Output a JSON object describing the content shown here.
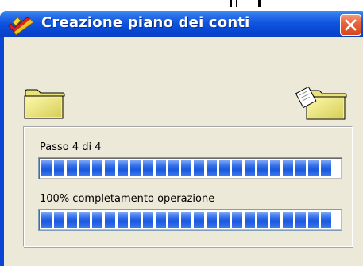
{
  "window": {
    "title": "Creazione piano dei conti",
    "title_icon": "app-check-icon",
    "close_icon": "close-x-icon"
  },
  "icons": {
    "source": "folder-icon",
    "destination": "folder-with-page-icon"
  },
  "progress": {
    "step_label": "Passo 4 di 4",
    "step_fraction": 1.0,
    "operation_label": "100% completamento operazione",
    "operation_fraction": 1.0
  },
  "colors": {
    "title_bar": "#0a45d6",
    "client_bg": "#ece9d8",
    "progress_segment": "#2f6de8",
    "close_button": "#e8653d"
  }
}
